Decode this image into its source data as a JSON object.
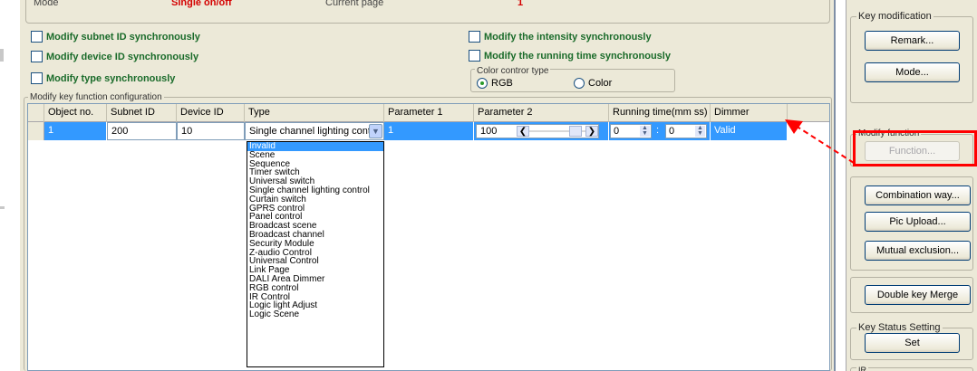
{
  "top_strip": {
    "mode_label": "Mode",
    "mode_value": "Single on/off",
    "current_page_label": "Current page",
    "current_page_value": "1"
  },
  "checkboxes": {
    "subnet": "Modify subnet ID synchronously",
    "device": "Modify device ID synchronously",
    "type": "Modify type synchronously",
    "intensity": "Modify the intensity synchronously",
    "running_time": "Modify the running time synchronously"
  },
  "color_type": {
    "legend": "Color contror type",
    "rgb": "RGB",
    "color": "Color",
    "selected": "RGB"
  },
  "config": {
    "legend": "Modify key function configuration",
    "columns": [
      "Object no.",
      "Subnet ID",
      "Device ID",
      "Type",
      "Parameter 1",
      "Parameter 2",
      "Running time(mm ss)",
      "Dimmer"
    ],
    "row": {
      "object_no": "1",
      "subnet_id": "200",
      "device_id": "10",
      "type": "Single channel lighting control",
      "parameter1": "1",
      "parameter2": "100",
      "run_min": "0",
      "run_sep": ":",
      "run_sec": "0",
      "dimmer": "Valid"
    }
  },
  "type_options": [
    "Invalid",
    "Scene",
    "Sequence",
    "Timer switch",
    "Universal switch",
    "Single channel lighting control",
    "Curtain switch",
    "GPRS control",
    "Panel control",
    "Broadcast scene",
    "Broadcast channel",
    "Security Module",
    "Z-audio Control",
    "Universal Control",
    "Link Page",
    "DALI Area Dimmer",
    "RGB control",
    "IR Control",
    "Logic light Adjust",
    "Logic Scene"
  ],
  "type_highlighted": "Invalid",
  "right_panel": {
    "key_mod_legend": "Key modification",
    "remark": "Remark...",
    "mode": "Mode...",
    "modify_function_legend": "Modify function",
    "function": "Function...",
    "combination": "Combination way...",
    "pic_upload": "Pic Upload...",
    "mutual": "Mutual exclusion...",
    "double_key": "Double key Merge",
    "key_status_legend": "Key Status Setting",
    "set": "Set",
    "bottom_legend": "IR"
  },
  "colors": {
    "panel_bg": "#ece9d8",
    "selection": "#3399ff",
    "checkbox_text": "#1a6b2a",
    "annotation_red": "#ff0000"
  }
}
